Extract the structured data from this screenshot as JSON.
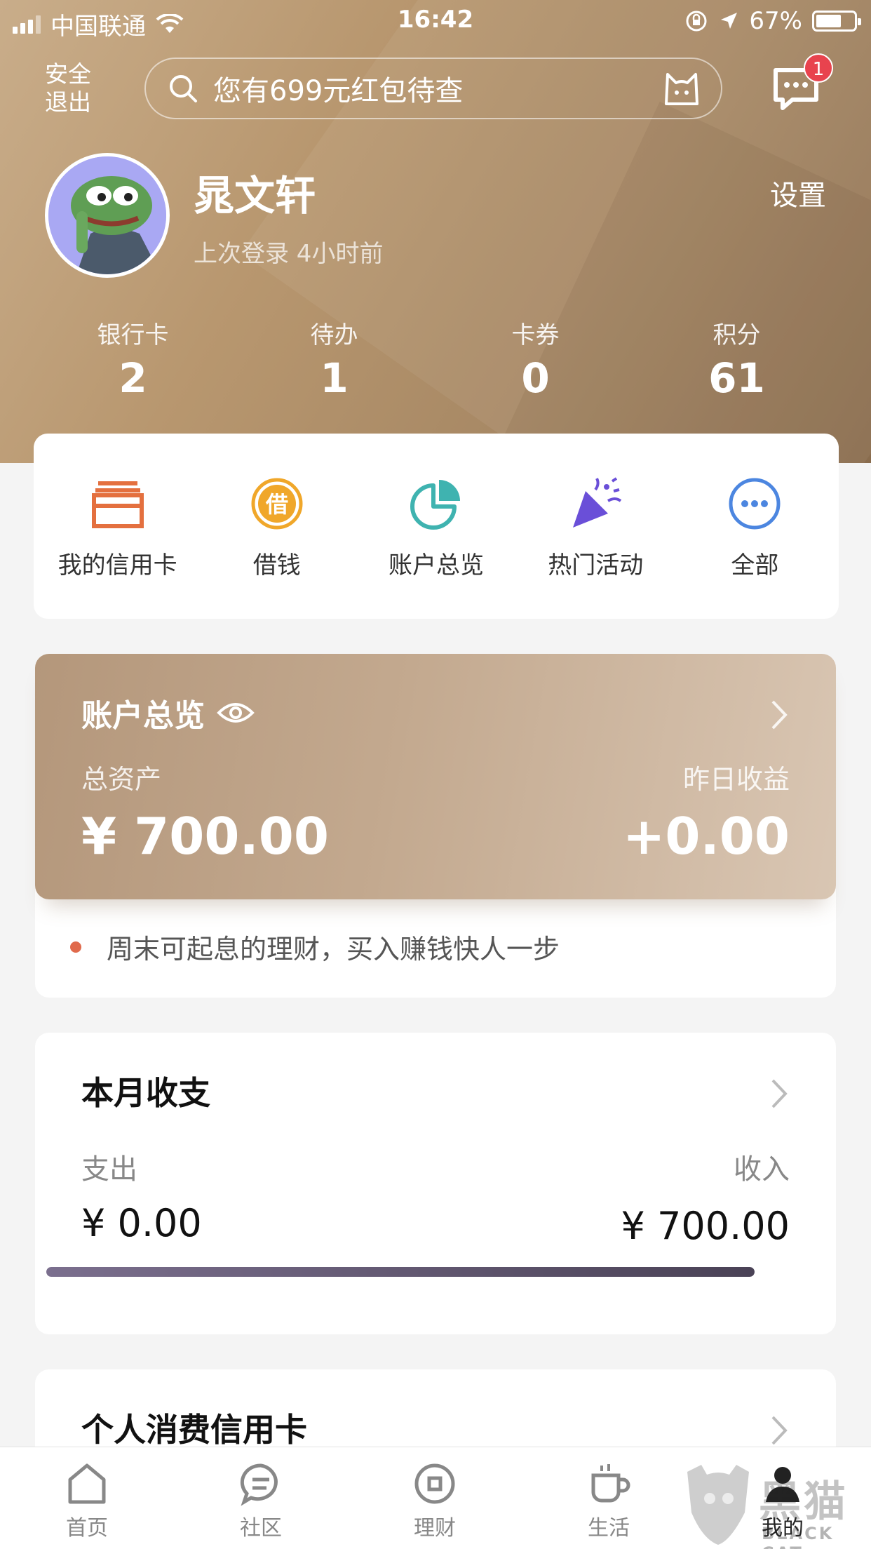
{
  "status_bar": {
    "carrier": "中国联通",
    "time": "16:42",
    "battery": "67%"
  },
  "header": {
    "logout_label": "安全退出",
    "search_placeholder": "您有699元红包待查",
    "message_badge": "1"
  },
  "profile": {
    "name": "晁文轩",
    "last_login": "上次登录 4小时前",
    "settings_label": "设置"
  },
  "stats": [
    {
      "label": "银行卡",
      "value": "2"
    },
    {
      "label": "待办",
      "value": "1"
    },
    {
      "label": "卡券",
      "value": "0"
    },
    {
      "label": "积分",
      "value": "61"
    }
  ],
  "quick_menu": [
    {
      "label": "我的信用卡",
      "icon": "credit-card-icon",
      "color": "#e4703f"
    },
    {
      "label": "借钱",
      "icon": "borrow-icon",
      "color": "#f0a72a"
    },
    {
      "label": "账户总览",
      "icon": "pie-chart-icon",
      "color": "#3fb3b0"
    },
    {
      "label": "热门活动",
      "icon": "party-popper-icon",
      "color": "#6a4fd8"
    },
    {
      "label": "全部",
      "icon": "more-icon",
      "color": "#4c86e0"
    }
  ],
  "account_overview": {
    "title": "账户总览",
    "total_assets_label": "总资产",
    "total_assets": "¥ 700.00",
    "yesterday_label": "昨日收益",
    "yesterday_value": "+0.00",
    "tip": "周末可起息的理财，买入赚钱快人一步"
  },
  "monthly": {
    "title": "本月收支",
    "expense_label": "支出",
    "expense_value": "¥ 0.00",
    "income_label": "收入",
    "income_value": "¥ 700.00",
    "income_share": 1.0
  },
  "credit_section": {
    "title": "个人消费信用卡"
  },
  "tabbar": [
    {
      "label": "首页",
      "icon": "home-icon"
    },
    {
      "label": "社区",
      "icon": "community-icon"
    },
    {
      "label": "理财",
      "icon": "finance-icon"
    },
    {
      "label": "生活",
      "icon": "coffee-icon"
    },
    {
      "label": "我的",
      "icon": "user-icon",
      "active": true
    }
  ],
  "watermark": {
    "text": "黑猫",
    "sub": "BLACK CAT"
  }
}
